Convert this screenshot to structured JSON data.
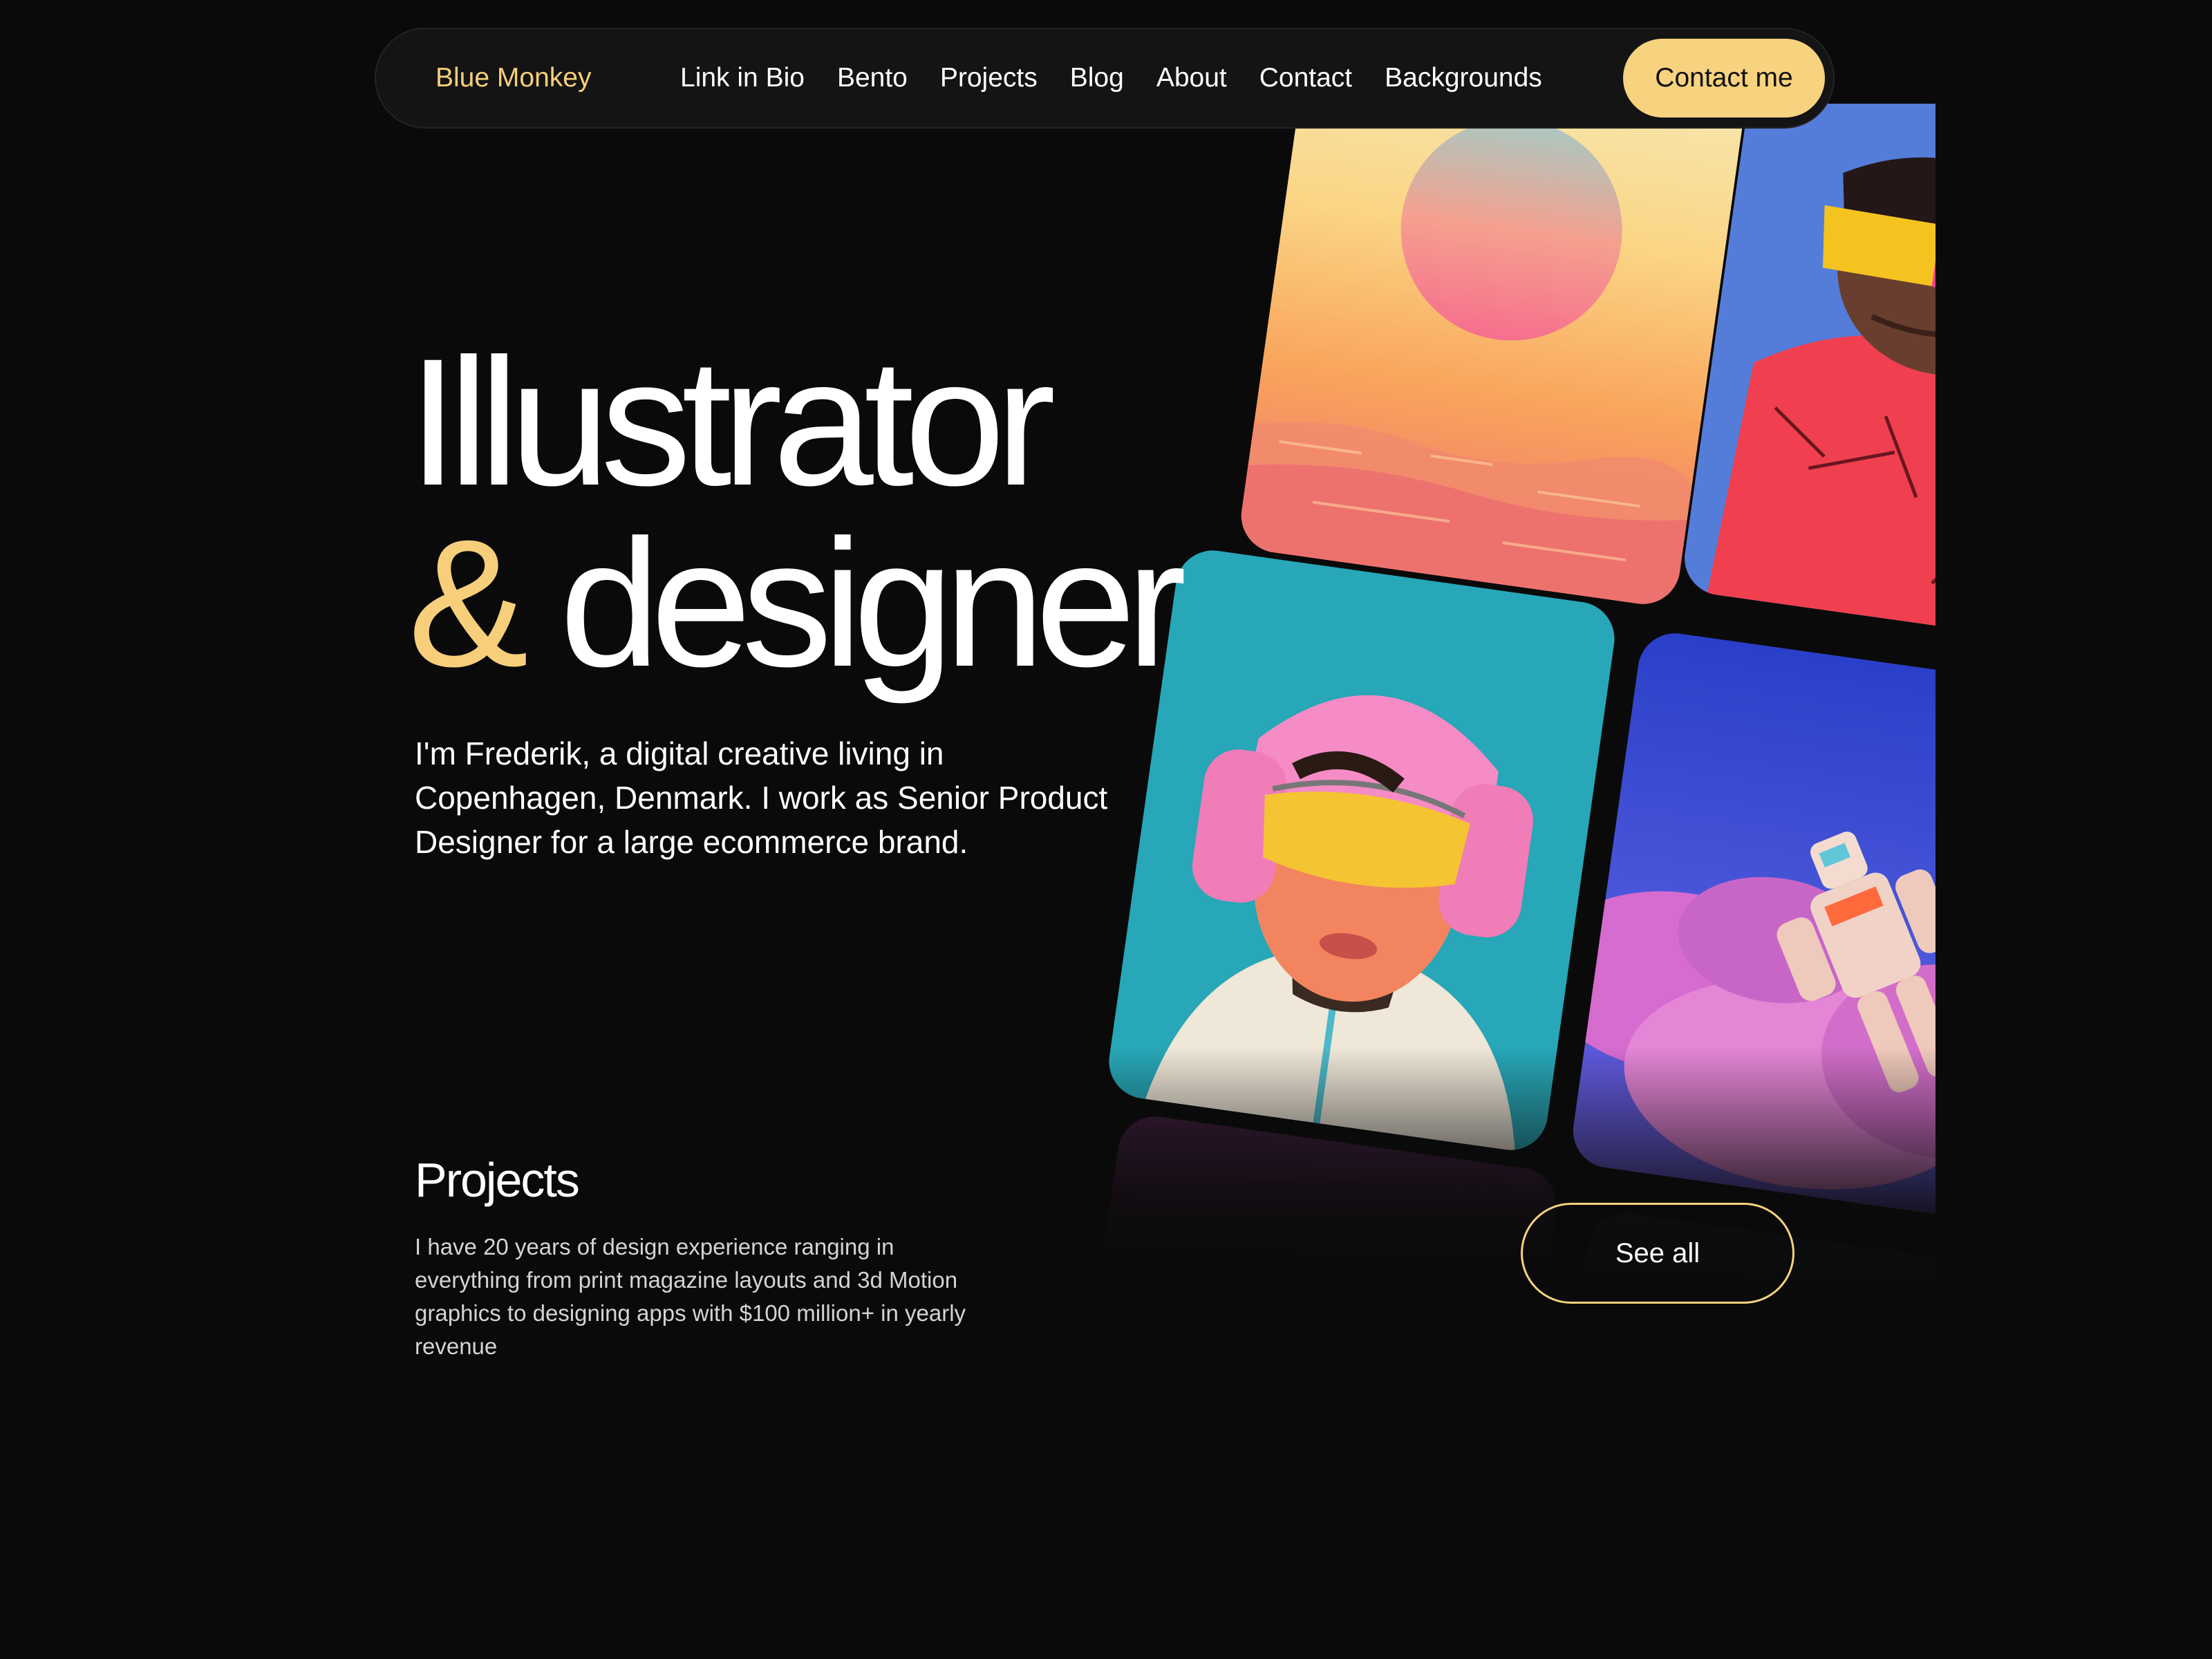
{
  "nav": {
    "brand": "Blue Monkey",
    "links": [
      "Link in Bio",
      "Bento",
      "Projects",
      "Blog",
      "About",
      "Contact",
      "Backgrounds"
    ],
    "cta": "Contact me"
  },
  "hero": {
    "title_line1": "Illustrator",
    "title_amp": "&",
    "title_word2": " designer",
    "description": "I'm Frederik, a digital creative living in Copenhagen, Denmark. I work as Senior Product Designer for a large ecommerce brand."
  },
  "projects": {
    "heading": "Projects",
    "description": "I have 20 years of design experience ranging in everything from print magazine layouts and 3d Motion graphics to designing apps with $100 million+ in yearly revenue",
    "see_all": "See all"
  },
  "gallery": {
    "items": [
      "sunset-illustration",
      "visor-portrait-illustration",
      "headphones-portrait-illustration",
      "floating-robot-illustration"
    ]
  },
  "colors": {
    "background": "#0a0a0a",
    "accent": "#f7cf7a",
    "button": "#f7d27f"
  }
}
